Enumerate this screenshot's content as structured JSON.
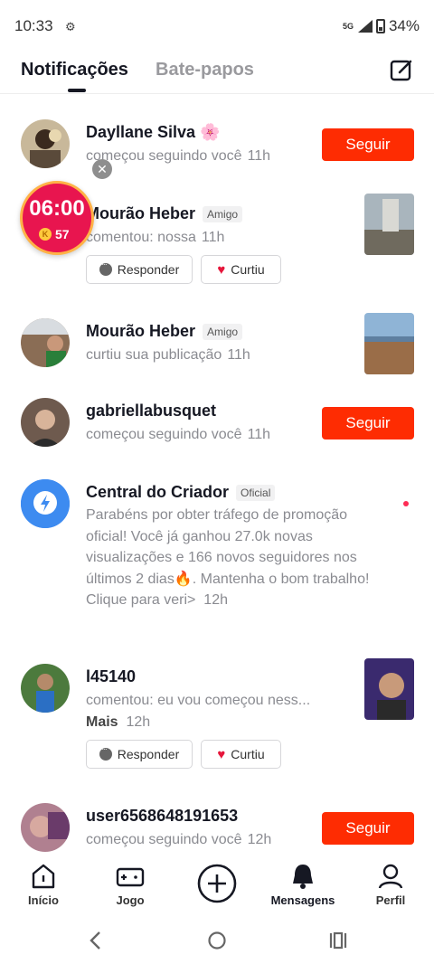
{
  "status": {
    "time": "10:33",
    "network": "5G",
    "battery": "34%"
  },
  "tabs": {
    "notifications": "Notificações",
    "chats": "Bate-papos"
  },
  "timer": {
    "time": "06:00",
    "coins": "57"
  },
  "items": [
    {
      "name": "Dayllane Silva 🌸",
      "text": "começou seguindo você",
      "time": "11h",
      "button": "Seguir"
    },
    {
      "name": "Mourão Heber",
      "badge": "Amigo",
      "text": "comentou: nossa",
      "time": "11h",
      "reply": "Responder",
      "like": "Curtiu"
    },
    {
      "name": "Mourão Heber",
      "badge": "Amigo",
      "text": "curtiu sua publicação",
      "time": "11h"
    },
    {
      "name": "gabriellabusquet",
      "text": "começou seguindo você",
      "time": "11h",
      "button": "Seguir"
    },
    {
      "name": "Central do Criador",
      "badge": "Oficial",
      "text": "Parabéns por obter tráfego de promoção oficial! Você já ganhou 27.0k novas visualizações e 166 novos seguidores nos últimos 2 dias🔥. Mantenha o bom trabalho! Clique para veri>",
      "time": "12h"
    },
    {
      "name": "l45140",
      "text": "comentou: eu vou começou ness...",
      "more": "Mais",
      "time": "12h",
      "reply": "Responder",
      "like": "Curtiu"
    },
    {
      "name": "user6568648191653",
      "text": "começou seguindo você",
      "time": "12h",
      "button": "Seguir"
    }
  ],
  "nav": {
    "home": "Início",
    "game": "Jogo",
    "messages": "Mensagens",
    "profile": "Perfil"
  },
  "colors": {
    "accent": "#fe2c02",
    "text": "#161823",
    "muted": "#8a8b91"
  }
}
